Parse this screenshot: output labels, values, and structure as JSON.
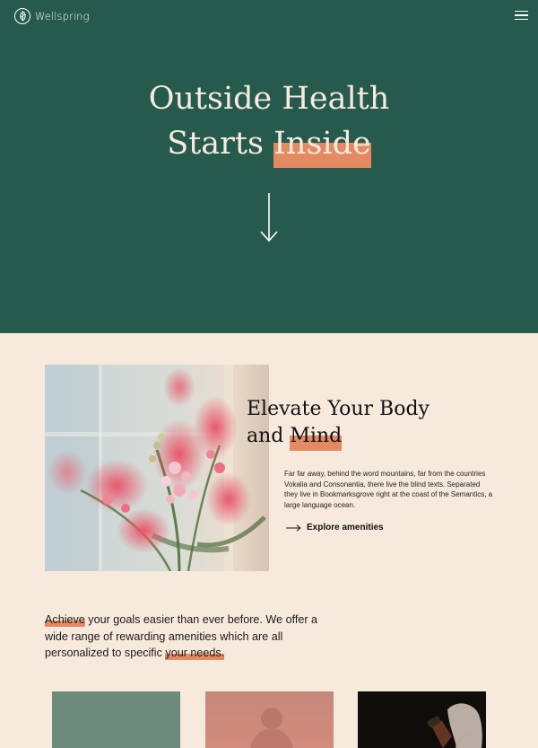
{
  "header": {
    "brand": "Wellspring",
    "logo_icon": "leaf-icon",
    "menu_icon": "hamburger-menu-icon"
  },
  "hero": {
    "title_line1": "Outside Health",
    "title_line2_start": "Starts",
    "title_line2_highlight": "Inside",
    "scroll_icon": "arrow-down-icon"
  },
  "feature": {
    "title_line1": "Elevate Your Body",
    "title_line2_start": "and",
    "title_line2_highlight": "Mind",
    "description": "Far far away, behind the word mountains, far from the countries Vokalia and Consonantia, there live the blind texts. Separated they live in Bookmarksgrove right at the coast of the Semantics, a large language ocean.",
    "link_label": "Explore amenities",
    "link_icon": "arrow-right-icon"
  },
  "intro": {
    "highlight_start": "Achieve",
    "body": " your goals easier than ever before. We offer a wide range of rewarding amenities which are all personalized to specific ",
    "highlight_end": "your needs."
  },
  "colors": {
    "hero_bg": "#265a4c",
    "page_bg": "#f8e9dd",
    "accent": "#e48a63",
    "hero_text": "#f7ebe0"
  }
}
